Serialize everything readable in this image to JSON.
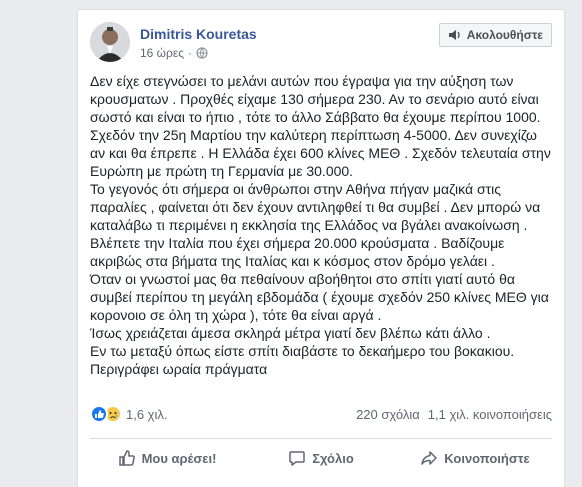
{
  "post": {
    "author": "Dimitris Kouretas",
    "time": "16 ώρες",
    "separator": "·",
    "follow_label": "Ακολουθήστε",
    "paragraphs": [
      "Δεν είχε στεγνώσει το μελάνι αυτών που έγραψα για την αύξηση των κρουσματων . Προχθές είχαμε 130 σήμερα 230. Αν το σενάριο αυτό είναι σωστό και είναι το ήπιο , τότε το άλλο Σάββατο θα έχουμε περίπου 1000. Σχεδόν την 25η Μαρτίου την καλύτερη περίπτωση 4-5000. Δεν συνεχίζω αν και θα έπρεπε . Η Ελλάδα έχει 600 κλίνες ΜΕΘ . Σχεδόν τελευταία στην Ευρώπη με πρώτη τη Γερμανία με 30.000.",
      "Το γεγονός ότι σήμερα οι άνθρωποι στην Αθήνα πήγαν μαζικά στις παραλίες , φαίνεται ότι δεν έχουν αντιληφθεί τι θα συμβεί . Δεν μπορώ να καταλάβω τι περιμένει η εκκλησία της Ελλάδος να βγάλει ανακοίνωση .",
      "Βλέπετε την Ιταλία που έχει σήμερα 20.000 κρούσματα . Βαδίζουμε ακριβώς στα βήματα της Ιταλίας και κ κόσμος στον δρόμο γελάει .",
      "Όταν οι γνωστοί μας θα πεθαίνουν αβοήθητοι στο σπίτι γιατί αυτό θα συμβεί περίπου τη μεγάλη εβδομάδα ( έχουμε σχεδόν 250 κλίνες ΜΕΘ για κορονοιο σε όλη τη χώρα ), τότε θα είναι αργά .",
      "Ίσως χρειάζεται άμεσα σκληρά μέτρα γιατί δεν βλέπω κάτι άλλο .",
      "Εν τω μεταξύ όπως είστε σπίτι διαβάστε το δεκαήμερο του βοκακιου.",
      "Περιγράφει ωραία πράγματα"
    ]
  },
  "stats": {
    "reactions_count": "1,6 χιλ.",
    "comments": "220 σχόλια",
    "shares": "1,1 χιλ. κοινοποιήσεις"
  },
  "actions": {
    "like": "Μου αρέσει!",
    "comment": "Σχόλιο",
    "share": "Κοινοποιήστε"
  },
  "colors": {
    "author_link": "#385898",
    "like_blue": "#1877f2",
    "sad_yellow": "#f7c94b"
  },
  "icons": [
    "avatar",
    "globe-icon",
    "follow-icon",
    "like-reaction-icon",
    "sad-reaction-icon",
    "thumbs-up-icon",
    "comment-icon",
    "share-icon"
  ]
}
